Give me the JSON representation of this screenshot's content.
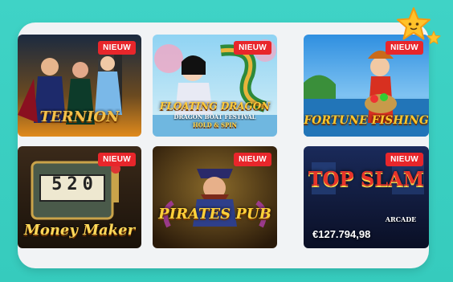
{
  "games": [
    {
      "name": "Ternion",
      "title": "TERNION",
      "badge": "NIEUW"
    },
    {
      "name": "Floating Dragon",
      "title": "FLOATING DRAGON",
      "subtitle": "DRAGON BOAT FESTIVAL",
      "tag": "HOLD & SPIN",
      "badge": "NIEUW"
    },
    {
      "name": "Fortune Fishing",
      "title": "FORTUNE FISHING",
      "badge": "NIEUW"
    },
    {
      "name": "Money Maker",
      "title": "Money Maker",
      "reel": "520",
      "badge": "NIEUW"
    },
    {
      "name": "Pirates Pub",
      "title": "PIRATES PUB",
      "badge": "NIEUW"
    },
    {
      "name": "Top Slam",
      "title": "TOP SLAM",
      "sub": "ARCADE",
      "badge": "NIEUW",
      "jackpot": "€127.794,98"
    }
  ],
  "icons": {
    "decoration": "star-icon"
  },
  "colors": {
    "background": "#3fd3c6",
    "badge": "#e8262b",
    "panel": "#f1f3f5"
  }
}
